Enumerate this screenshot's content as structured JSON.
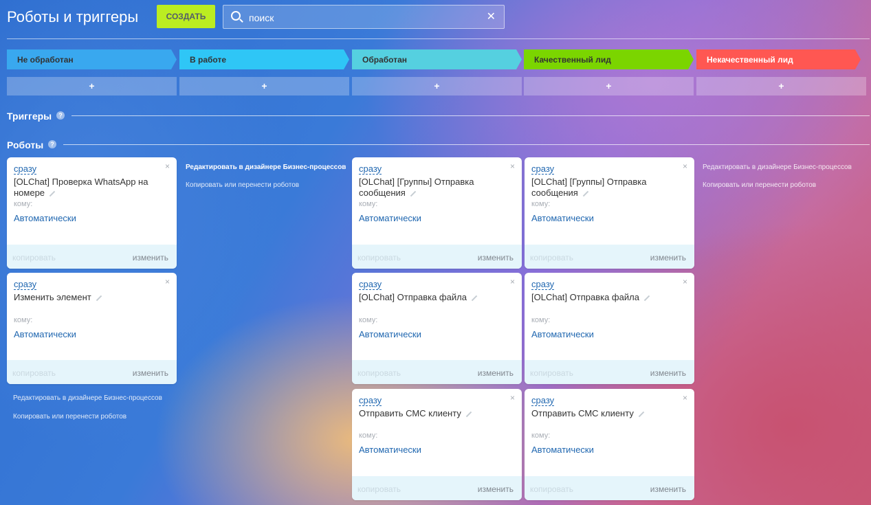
{
  "header": {
    "title": "Роботы и триггеры",
    "create_label": "СОЗДАТЬ",
    "search_value": "поиск",
    "clear_icon": "close-icon"
  },
  "stages": [
    {
      "label": "Не обработан",
      "color": "#39a8ef"
    },
    {
      "label": "В работе",
      "color": "#2fc6f6"
    },
    {
      "label": "Обработан",
      "color": "#55d0e0"
    },
    {
      "label": "Качественный лид",
      "color": "#7bd500"
    },
    {
      "label": "Некачественный лид",
      "color": "#ff5752"
    }
  ],
  "stage_add_label": "+",
  "triggers_label": "Триггеры",
  "robots_label": "Роботы",
  "help_label": "?",
  "card_common": {
    "delay": "сразу",
    "to_label": "кому:",
    "to_value": "Автоматически",
    "copy_label": "копировать",
    "edit_label": "изменить",
    "close_label": "×"
  },
  "columns": [
    {
      "robots": [
        {
          "title": "[OLChat] Проверка WhatsApp на номере"
        },
        {
          "title": "Изменить элемент"
        }
      ],
      "link_edit": "Редактировать в дизайнере Бизнес-процессов",
      "link_copy": "Копировать или перенести роботов"
    },
    {
      "robots": [],
      "link_edit": "Редактировать в дизайнере Бизнес-процессов",
      "link_copy": "Копировать или перенести роботов"
    },
    {
      "robots": [
        {
          "title": "[OLChat] [Группы] Отправка сообщения"
        },
        {
          "title": "[OLChat] Отправка файла"
        },
        {
          "title": "Отправить СМС клиенту"
        }
      ]
    },
    {
      "robots": [
        {
          "title": "[OLChat] [Группы] Отправка сообщения"
        },
        {
          "title": "[OLChat] Отправка файла"
        },
        {
          "title": "Отправить СМС клиенту"
        }
      ]
    },
    {
      "robots": [],
      "link_edit": "Редактировать в дизайнере Бизнес-процессов",
      "link_copy": "Копировать или перенести роботов"
    }
  ]
}
